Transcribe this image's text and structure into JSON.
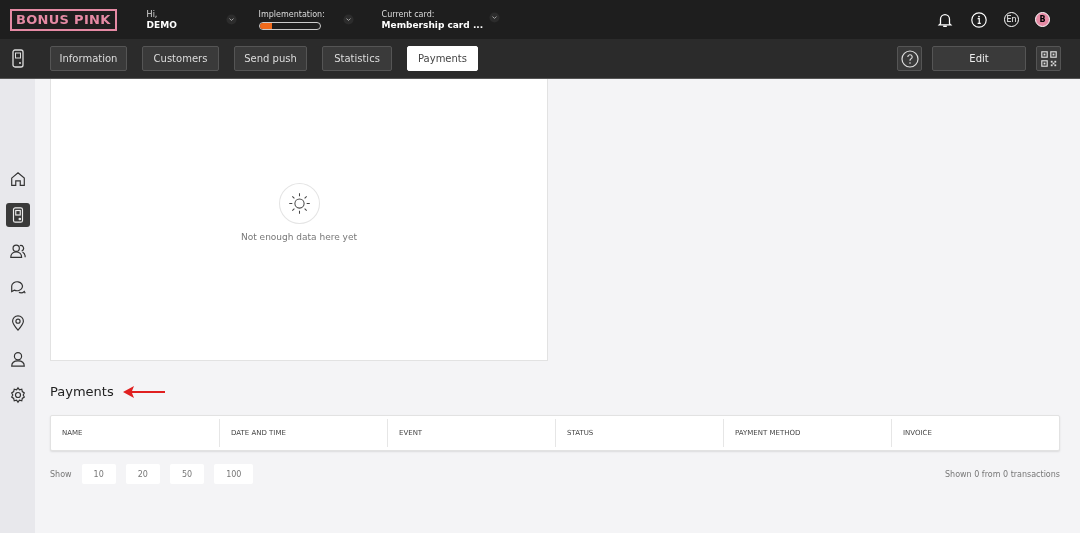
{
  "header": {
    "logo": "BONUS PINK",
    "greeting": "Hi,",
    "user": "DEMO",
    "implementation": {
      "label": "Implementation:",
      "level": 0.2
    },
    "card": {
      "label": "Current card:",
      "value": "Membership card ..."
    },
    "language": "En",
    "avatar": "B"
  },
  "tabs": [
    {
      "label": "Information",
      "selected": false
    },
    {
      "label": "Customers",
      "selected": false
    },
    {
      "label": "Send push",
      "selected": false
    },
    {
      "label": "Statistics",
      "selected": false
    },
    {
      "label": "Payments",
      "selected": true
    }
  ],
  "edit_button": "Edit",
  "sidebar": {
    "items": [
      {
        "kind": "home",
        "selected": false
      },
      {
        "kind": "card",
        "selected": true
      },
      {
        "kind": "customers",
        "selected": false
      },
      {
        "kind": "chat",
        "selected": false
      },
      {
        "kind": "location",
        "selected": false
      },
      {
        "kind": "profile",
        "selected": false
      },
      {
        "kind": "settings",
        "selected": false
      }
    ]
  },
  "empty_state": "Not enough data here yet",
  "payments": {
    "title": "Payments",
    "columns": [
      "NAME",
      "DATE AND TIME",
      "EVENT",
      "STATUS",
      "PAYMENT METHOD",
      "INVOICE"
    ],
    "show_label": "Show",
    "page_sizes": [
      "10",
      "20",
      "50",
      "100"
    ],
    "summary": "Shown 0 from 0 transactions"
  }
}
